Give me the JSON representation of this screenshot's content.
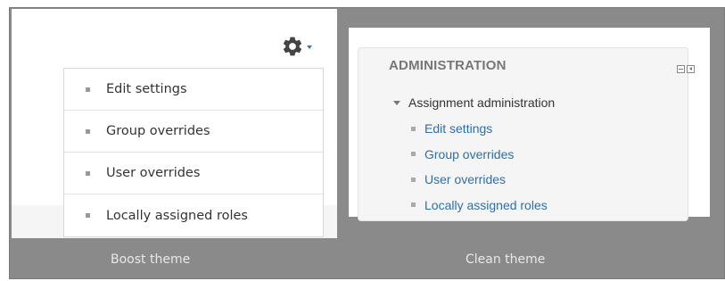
{
  "boost": {
    "items": [
      {
        "label": "Edit settings"
      },
      {
        "label": "Group overrides"
      },
      {
        "label": "User overrides"
      },
      {
        "label": "Locally assigned roles"
      }
    ],
    "caption": "Boost theme",
    "gear_icon": "gear-icon",
    "accent": "#2a7bb6"
  },
  "clean": {
    "block_title": "ADMINISTRATION",
    "tree_root": "Assignment administration",
    "links": [
      {
        "label": "Edit settings"
      },
      {
        "label": "Group overrides"
      },
      {
        "label": "User overrides"
      },
      {
        "label": "Locally assigned roles"
      }
    ],
    "caption": "Clean theme",
    "link_color": "#2a6fb0"
  }
}
